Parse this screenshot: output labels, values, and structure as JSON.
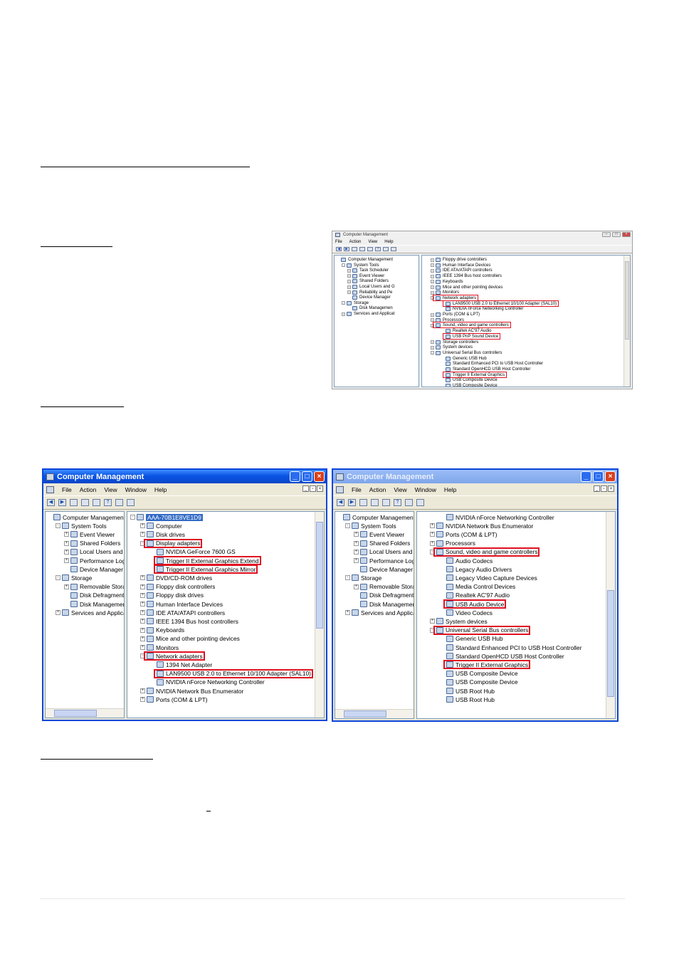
{
  "page": {
    "footer_line": true
  },
  "screenshot_small": {
    "title": "Computer Management",
    "menus": [
      "File",
      "Action",
      "View",
      "Help"
    ],
    "left_tree": [
      {
        "label": "Computer Management",
        "level": 0,
        "exp": ""
      },
      {
        "label": "System Tools",
        "level": 1,
        "exp": "-"
      },
      {
        "label": "Task Scheduler",
        "level": 2,
        "exp": "+"
      },
      {
        "label": "Event Viewer",
        "level": 2,
        "exp": "+"
      },
      {
        "label": "Shared Folders",
        "level": 2,
        "exp": "+"
      },
      {
        "label": "Local Users and G",
        "level": 2,
        "exp": "+"
      },
      {
        "label": "Reliability and Pe",
        "level": 2,
        "exp": "+"
      },
      {
        "label": "Device Manager",
        "level": 2,
        "exp": ""
      },
      {
        "label": "Storage",
        "level": 1,
        "exp": "-"
      },
      {
        "label": "Disk Managemen",
        "level": 2,
        "exp": ""
      },
      {
        "label": "Services and Applicat",
        "level": 1,
        "exp": "+"
      }
    ],
    "right_tree": [
      {
        "label": "Floppy drive controllers",
        "level": 0,
        "exp": "+"
      },
      {
        "label": "Human Interface Devices",
        "level": 0,
        "exp": "+"
      },
      {
        "label": "IDE ATA/ATAPI controllers",
        "level": 0,
        "exp": "+"
      },
      {
        "label": "IEEE 1394 Bus host controllers",
        "level": 0,
        "exp": "+"
      },
      {
        "label": "Keyboards",
        "level": 0,
        "exp": "+"
      },
      {
        "label": "Mice and other pointing devices",
        "level": 0,
        "exp": "+"
      },
      {
        "label": "Monitors",
        "level": 0,
        "exp": "+"
      },
      {
        "label": "Network adapters",
        "level": 0,
        "exp": "-",
        "hl": true
      },
      {
        "label": "LAN9500 USB 2.0 to Ethernet 10/100 Adapter (SAL10)",
        "level": 1,
        "exp": "",
        "hl": true
      },
      {
        "label": "NVIDIA nForce Networking Controller",
        "level": 1,
        "exp": ""
      },
      {
        "label": "Ports (COM & LPT)",
        "level": 0,
        "exp": "+"
      },
      {
        "label": "Processors",
        "level": 0,
        "exp": "+"
      },
      {
        "label": "Sound, video and game controllers",
        "level": 0,
        "exp": "-",
        "hl": true
      },
      {
        "label": "Realtek AC'97 Audio",
        "level": 1,
        "exp": ""
      },
      {
        "label": "USB PnP Sound Device",
        "level": 1,
        "exp": "",
        "hl": true
      },
      {
        "label": "Storage controllers",
        "level": 0,
        "exp": "+"
      },
      {
        "label": "System devices",
        "level": 0,
        "exp": "+"
      },
      {
        "label": "Universal Serial Bus controllers",
        "level": 0,
        "exp": "-"
      },
      {
        "label": "Generic USB Hub",
        "level": 1,
        "exp": ""
      },
      {
        "label": "Standard Enhanced PCI to USB Host Controller",
        "level": 1,
        "exp": ""
      },
      {
        "label": "Standard OpenHCD USB Host Controller",
        "level": 1,
        "exp": ""
      },
      {
        "label": "Trigger II External Graphics",
        "level": 1,
        "exp": "",
        "hl": true
      },
      {
        "label": "USB Composite Device",
        "level": 1,
        "exp": ""
      },
      {
        "label": "USB Composite Device",
        "level": 1,
        "exp": ""
      }
    ]
  },
  "screenshot_left": {
    "title": "Computer Management",
    "menus": [
      "File",
      "Action",
      "View",
      "Window",
      "Help"
    ],
    "left_tree": [
      {
        "label": "Computer Management (L",
        "level": 0,
        "exp": ""
      },
      {
        "label": "System Tools",
        "level": 1,
        "exp": "-"
      },
      {
        "label": "Event Viewer",
        "level": 2,
        "exp": "+"
      },
      {
        "label": "Shared Folders",
        "level": 2,
        "exp": "+"
      },
      {
        "label": "Local Users and G",
        "level": 2,
        "exp": "+"
      },
      {
        "label": "Performance Logs",
        "level": 2,
        "exp": "+"
      },
      {
        "label": "Device Manager",
        "level": 2,
        "exp": ""
      },
      {
        "label": "Storage",
        "level": 1,
        "exp": "-"
      },
      {
        "label": "Removable Storag",
        "level": 2,
        "exp": "+"
      },
      {
        "label": "Disk Defragmente",
        "level": 2,
        "exp": ""
      },
      {
        "label": "Disk Management",
        "level": 2,
        "exp": ""
      },
      {
        "label": "Services and Applicat",
        "level": 1,
        "exp": "+"
      }
    ],
    "right_tree": [
      {
        "label": "AAA-70B1E8VE1D9",
        "level": 0,
        "exp": "-",
        "sel": true
      },
      {
        "label": "Computer",
        "level": 1,
        "exp": "+"
      },
      {
        "label": "Disk drives",
        "level": 1,
        "exp": "+"
      },
      {
        "label": "Display adapters",
        "level": 1,
        "exp": "-",
        "hl": true
      },
      {
        "label": "NVIDIA GeForce 7600 GS",
        "level": 2,
        "exp": ""
      },
      {
        "label": "Trigger II External Graphics Extend",
        "level": 2,
        "exp": "",
        "hl": true
      },
      {
        "label": "Trigger II External Graphics Mirror",
        "level": 2,
        "exp": "",
        "hl": true
      },
      {
        "label": "DVD/CD-ROM drives",
        "level": 1,
        "exp": "+"
      },
      {
        "label": "Floppy disk controllers",
        "level": 1,
        "exp": "+"
      },
      {
        "label": "Floppy disk drives",
        "level": 1,
        "exp": "+"
      },
      {
        "label": "Human Interface Devices",
        "level": 1,
        "exp": "+"
      },
      {
        "label": "IDE ATA/ATAPI controllers",
        "level": 1,
        "exp": "+"
      },
      {
        "label": "IEEE 1394 Bus host controllers",
        "level": 1,
        "exp": "+"
      },
      {
        "label": "Keyboards",
        "level": 1,
        "exp": "+"
      },
      {
        "label": "Mice and other pointing devices",
        "level": 1,
        "exp": "+"
      },
      {
        "label": "Monitors",
        "level": 1,
        "exp": "+"
      },
      {
        "label": "Network adapters",
        "level": 1,
        "exp": "-",
        "hl": true
      },
      {
        "label": "1394 Net Adapter",
        "level": 2,
        "exp": ""
      },
      {
        "label": "LAN9500 USB 2.0 to Ethernet 10/100 Adapter (SAL10)",
        "level": 2,
        "exp": "",
        "hl": true
      },
      {
        "label": "NVIDIA nForce Networking Controller",
        "level": 2,
        "exp": ""
      },
      {
        "label": "NVIDIA Network Bus Enumerator",
        "level": 1,
        "exp": "+"
      },
      {
        "label": "Ports (COM & LPT)",
        "level": 1,
        "exp": "+"
      }
    ]
  },
  "screenshot_right": {
    "title": "Computer Management",
    "menus": [
      "File",
      "Action",
      "View",
      "Window",
      "Help"
    ],
    "left_tree": [
      {
        "label": "Computer Management (L",
        "level": 0,
        "exp": ""
      },
      {
        "label": "System Tools",
        "level": 1,
        "exp": "-"
      },
      {
        "label": "Event Viewer",
        "level": 2,
        "exp": "+"
      },
      {
        "label": "Shared Folders",
        "level": 2,
        "exp": "+"
      },
      {
        "label": "Local Users and G",
        "level": 2,
        "exp": "+"
      },
      {
        "label": "Performance Logs",
        "level": 2,
        "exp": "+"
      },
      {
        "label": "Device Manager",
        "level": 2,
        "exp": ""
      },
      {
        "label": "Storage",
        "level": 1,
        "exp": "-"
      },
      {
        "label": "Removable Storag",
        "level": 2,
        "exp": "+"
      },
      {
        "label": "Disk Defragmente",
        "level": 2,
        "exp": ""
      },
      {
        "label": "Disk Management",
        "level": 2,
        "exp": ""
      },
      {
        "label": "Services and Applicat",
        "level": 1,
        "exp": "+"
      }
    ],
    "right_tree": [
      {
        "label": "NVIDIA nForce Networking Controller",
        "level": 2,
        "exp": ""
      },
      {
        "label": "NVIDIA Network Bus Enumerator",
        "level": 1,
        "exp": "+"
      },
      {
        "label": "Ports (COM & LPT)",
        "level": 1,
        "exp": "+"
      },
      {
        "label": "Processors",
        "level": 1,
        "exp": "+"
      },
      {
        "label": "Sound, video and game controllers",
        "level": 1,
        "exp": "-",
        "hl": true
      },
      {
        "label": "Audio Codecs",
        "level": 2,
        "exp": ""
      },
      {
        "label": "Legacy Audio Drivers",
        "level": 2,
        "exp": ""
      },
      {
        "label": "Legacy Video Capture Devices",
        "level": 2,
        "exp": ""
      },
      {
        "label": "Media Control Devices",
        "level": 2,
        "exp": ""
      },
      {
        "label": "Realtek AC'97 Audio",
        "level": 2,
        "exp": ""
      },
      {
        "label": "USB Audio Device",
        "level": 2,
        "exp": "",
        "hl": true
      },
      {
        "label": "Video Codecs",
        "level": 2,
        "exp": ""
      },
      {
        "label": "System devices",
        "level": 1,
        "exp": "+"
      },
      {
        "label": "Universal Serial Bus controllers",
        "level": 1,
        "exp": "-",
        "hl": true
      },
      {
        "label": "Generic USB Hub",
        "level": 2,
        "exp": ""
      },
      {
        "label": "Standard Enhanced PCI to USB Host Controller",
        "level": 2,
        "exp": ""
      },
      {
        "label": "Standard OpenHCD USB Host Controller",
        "level": 2,
        "exp": ""
      },
      {
        "label": "Trigger II External Graphics",
        "level": 2,
        "exp": "",
        "hl": true
      },
      {
        "label": "USB Composite Device",
        "level": 2,
        "exp": ""
      },
      {
        "label": "USB Composite Device",
        "level": 2,
        "exp": ""
      },
      {
        "label": "USB Root Hub",
        "level": 2,
        "exp": ""
      },
      {
        "label": "USB Root Hub",
        "level": 2,
        "exp": ""
      }
    ]
  },
  "colors": {
    "highlight_box": "#e01020",
    "xp_title_blue": "#0a54e4",
    "selection_blue": "#316ac5"
  }
}
